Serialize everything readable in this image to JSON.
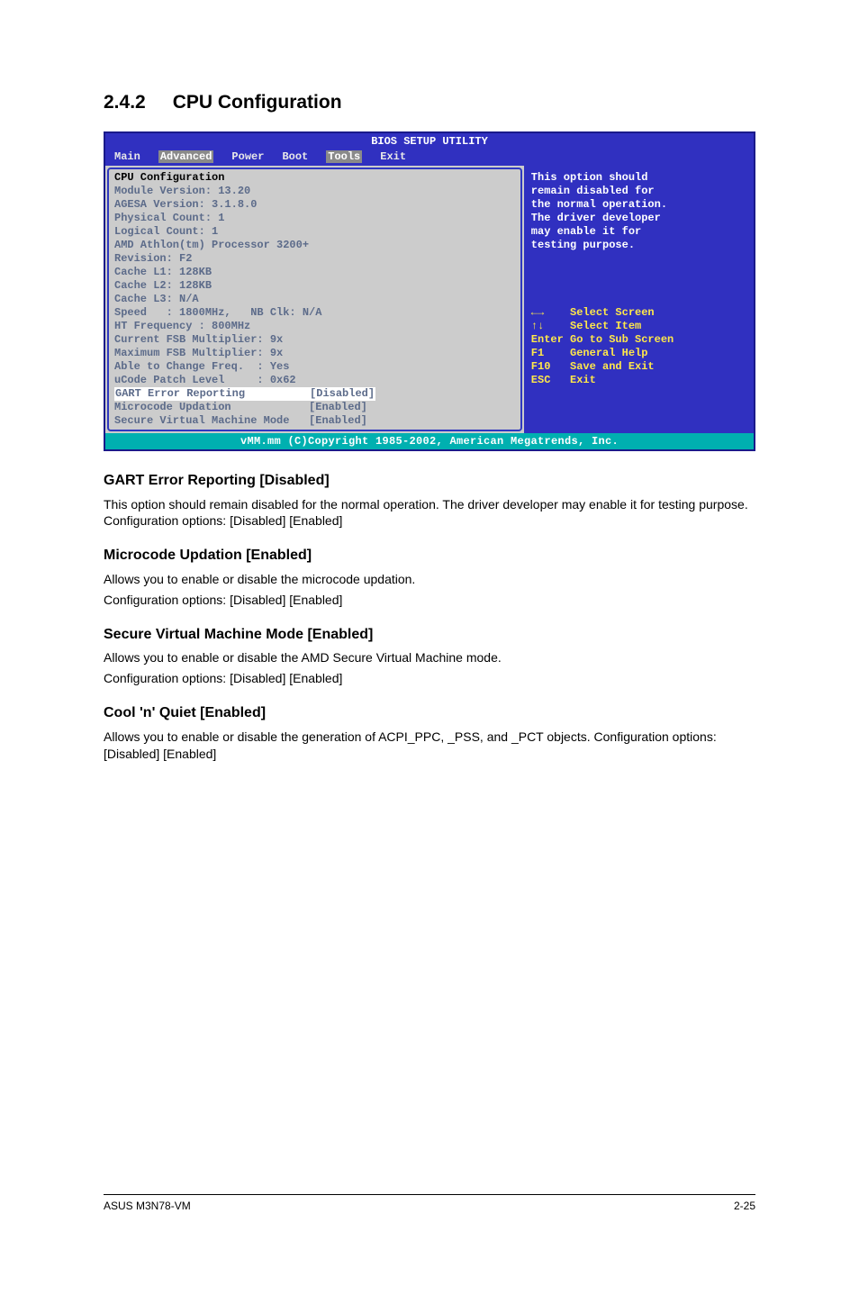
{
  "section": {
    "number": "2.4.2",
    "title": "CPU Configuration"
  },
  "bios": {
    "title": "BIOS SETUP UTILITY",
    "menu": {
      "main": "Main",
      "advanced": "Advanced",
      "power": "Power",
      "boot": "Boot",
      "tools": "Tools",
      "exit": "Exit"
    },
    "left": {
      "header": "CPU Configuration",
      "module": "Module Version: 13.20",
      "agesa": "AGESA Version: 3.1.8.0",
      "physical": "Physical Count: 1",
      "logical": "Logical Count: 1",
      "proc": "AMD Athlon(tm) Processor 3200+",
      "rev": "Revision: F2",
      "l1": "Cache L1: 128KB",
      "l2": "Cache L2: 128KB",
      "l3": "Cache L3: N/A",
      "speed": "Speed   : 1800MHz,   NB Clk: N/A",
      "ht": "HT Frequency : 800MHz",
      "cur": "Current FSB Multiplier: 9x",
      "max": "Maximum FSB Multiplier: 9x",
      "able": "Able to Change Freq.  : Yes",
      "ucode": "uCode Patch Level     : 0x62",
      "gart_label": "GART Error Reporting",
      "gart_val": "[Disabled]",
      "micro_label": "Microcode Updation",
      "micro_val": "[Enabled]",
      "svm_label": "Secure Virtual Machine Mode",
      "svm_val": "[Enabled]"
    },
    "right": {
      "help1": "This option should",
      "help2": "remain disabled for",
      "help3": "the normal operation.",
      "help4": "The driver developer",
      "help5": "may enable it for",
      "help6": "testing purpose.",
      "k_lr": "←→",
      "k_lr_t": "Select Screen",
      "k_ud": "↑↓",
      "k_ud_t": "Select Item",
      "k_ent": "Enter",
      "k_ent_t": "Go to Sub Screen",
      "k_f1": "F1",
      "k_f1_t": "General Help",
      "k_f10": "F10",
      "k_f10_t": "Save and Exit",
      "k_esc": "ESC",
      "k_esc_t": "Exit"
    },
    "footer": "vMM.mm (C)Copyright 1985-2002, American Megatrends, Inc."
  },
  "content": {
    "h1": "GART Error Reporting [Disabled]",
    "p1": "This option should remain disabled for the normal operation. The driver developer may enable it for testing purpose. Configuration options: [Disabled] [Enabled]",
    "h2": "Microcode Updation [Enabled]",
    "p2a": "Allows you to enable or disable the microcode updation.",
    "p2b": "Configuration options: [Disabled] [Enabled]",
    "h3": "Secure Virtual Machine Mode [Enabled]",
    "p3a": "Allows you to enable or disable the AMD Secure Virtual Machine mode.",
    "p3b": "Configuration options: [Disabled] [Enabled]",
    "h4": "Cool 'n' Quiet [Enabled]",
    "p4": "Allows you to enable or disable the generation of ACPI_PPC, _PSS, and _PCT objects. Configuration options: [Disabled] [Enabled]"
  },
  "footer": {
    "left": "ASUS M3N78-VM",
    "right": "2-25"
  }
}
